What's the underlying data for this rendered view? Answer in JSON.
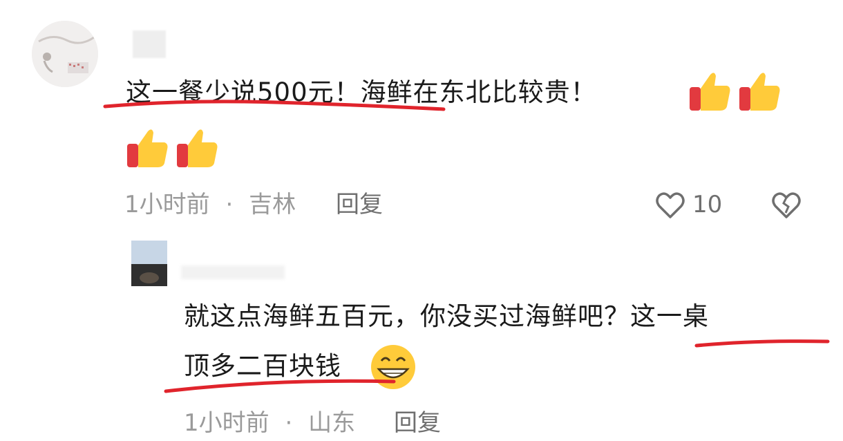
{
  "comment": {
    "text_line1": "这一餐少说500元！海鲜在东北比较贵！",
    "time": "1小时前",
    "location": "吉林",
    "separator": "·",
    "reply_label": "回复",
    "like_count": "10",
    "emojis": [
      "thumbs-up",
      "thumbs-up",
      "thumbs-up",
      "thumbs-up"
    ]
  },
  "reply": {
    "text_line1": "就这点海鲜五百元，你没买过海鲜吧？这一桌",
    "text_line2": "顶多二百块钱",
    "time": "1小时前",
    "location": "山东",
    "separator": "·",
    "reply_label": "回复",
    "emoji": "grin"
  },
  "colors": {
    "underline": "#e0242c",
    "meta": "#9a9a9a",
    "text": "#1a1a1a"
  }
}
